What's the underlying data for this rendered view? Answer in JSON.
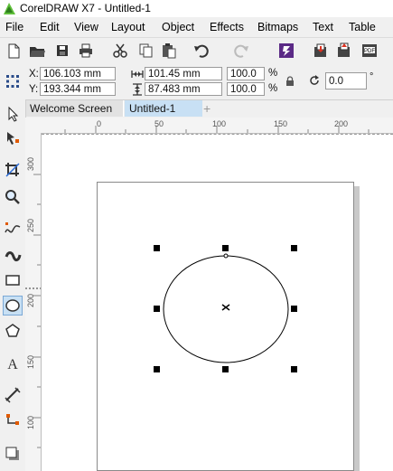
{
  "window": {
    "title": "CorelDRAW X7 - Untitled-1"
  },
  "menu": [
    "File",
    "Edit",
    "View",
    "Layout",
    "Object",
    "Effects",
    "Bitmaps",
    "Text",
    "Table"
  ],
  "properties": {
    "x": "106.103 mm",
    "y": "193.344 mm",
    "width": "101.45 mm",
    "height": "87.483 mm",
    "scale_w": "100.0",
    "scale_h": "100.0",
    "percent": "%",
    "rotation": "0.0",
    "degree": "°",
    "x_label": "X:",
    "y_label": "Y:"
  },
  "tabs": {
    "welcome": "Welcome Screen",
    "doc": "Untitled-1",
    "add": "+"
  },
  "ruler": {
    "h_ticks": [
      "0",
      "50",
      "100",
      "150",
      "200"
    ],
    "v_ticks": [
      "300",
      "250",
      "200",
      "150",
      "100"
    ]
  },
  "colors": {
    "accent": "#c8e0f4",
    "selection": "#000000",
    "cdr_logo": "#5fbf3a"
  },
  "icons": {
    "toolbar": [
      "new-icon",
      "open-icon",
      "save-icon",
      "print-icon",
      "cut-icon",
      "copy-icon",
      "paste-icon",
      "undo-icon",
      "redo-icon",
      "corel-connect-icon",
      "import-icon",
      "export-icon",
      "publish-pdf-icon"
    ],
    "toolbox": [
      "pick-tool-icon",
      "shape-tool-icon",
      "crop-tool-icon",
      "zoom-tool-icon",
      "freehand-tool-icon",
      "artistic-media-icon",
      "rectangle-tool-icon",
      "ellipse-tool-icon",
      "polygon-tool-icon",
      "text-tool-icon",
      "dimension-tool-icon",
      "connector-tool-icon",
      "drop-shadow-tool-icon"
    ]
  }
}
